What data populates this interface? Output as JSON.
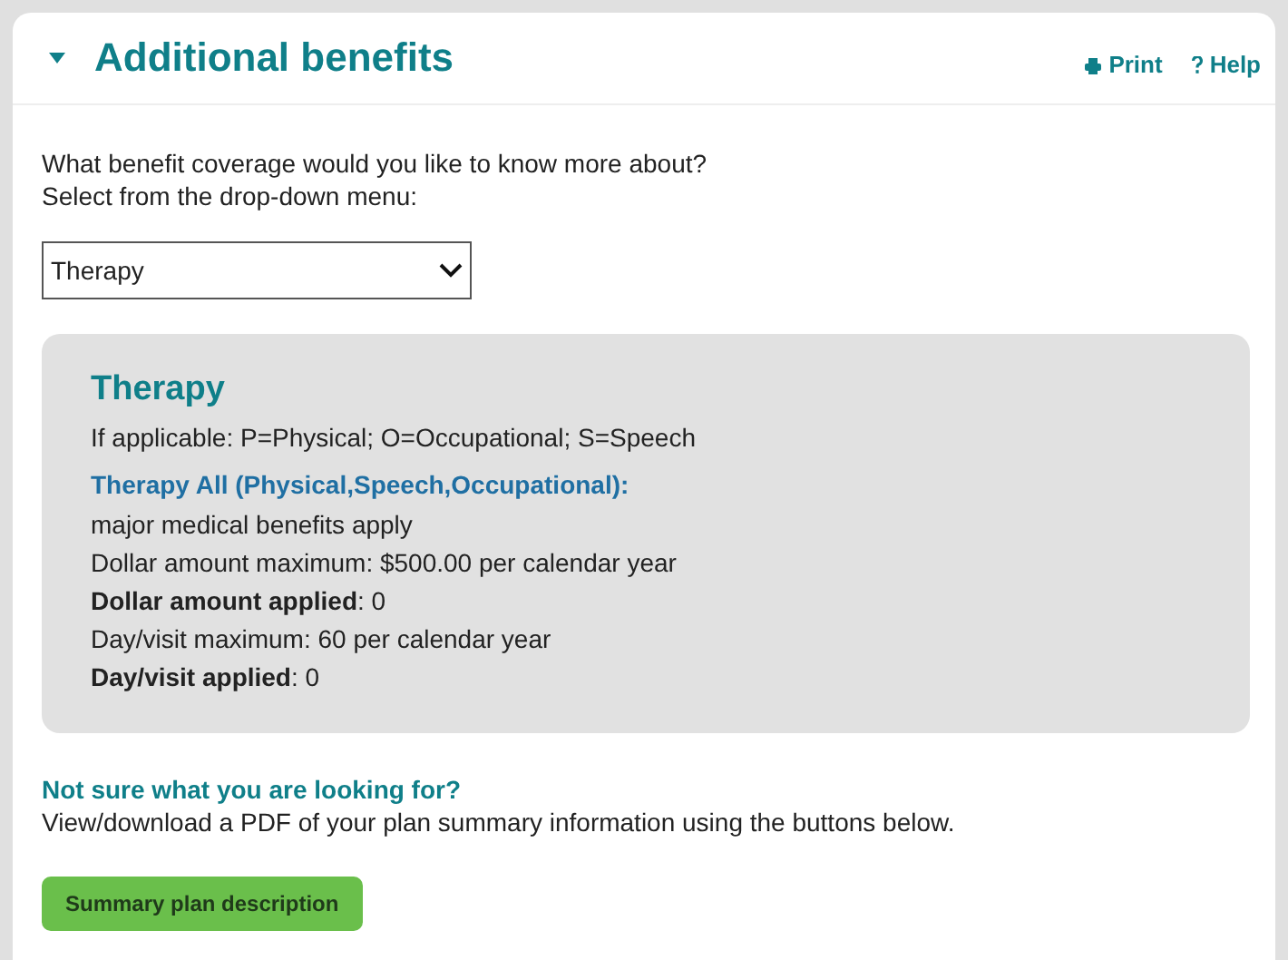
{
  "section": {
    "title": "Additional benefits",
    "expanded": true,
    "actions": [
      {
        "kind": "print",
        "label": "Print"
      },
      {
        "kind": "help",
        "label": "Help"
      }
    ]
  },
  "prompt": [
    "What benefit coverage would you like to know more about?",
    "Select from the drop-down menu:"
  ],
  "select": {
    "value": "Therapy"
  },
  "benefit": {
    "title": "Therapy",
    "note": "If applicable: P=Physical; O=Occupational; S=Speech",
    "subtitle": "Therapy All (Physical,Speech,Occupational):",
    "lines": [
      "major medical benefits apply",
      "Dollar amount maximum: $500.00 per calendar year",
      "**Dollar amount applied**: 0",
      "Day/visit maximum: 60 per calendar year",
      "**Day/visit applied**: 0"
    ]
  },
  "help": {
    "title": "Not sure what you are looking for?",
    "text": "View/download a PDF of your plan summary information using the buttons below."
  },
  "buttons": [
    "Summary plan description"
  ]
}
